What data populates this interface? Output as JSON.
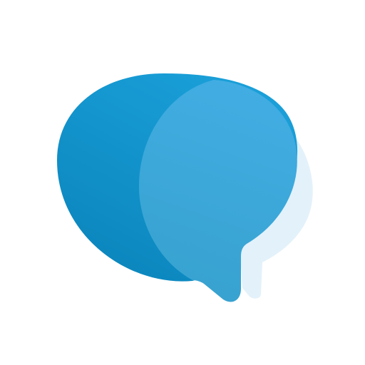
{
  "logo": {
    "icon": "chat-bubbles-icon",
    "colors": {
      "background": "#ffffff",
      "back_bubble_light": "#1a9fd8",
      "back_bubble_dark": "#0b86bd",
      "front_bubble_light": "#41ade3",
      "front_bubble_dark": "#37a2cf",
      "shadow_bubble": "#e3f1fa"
    }
  }
}
